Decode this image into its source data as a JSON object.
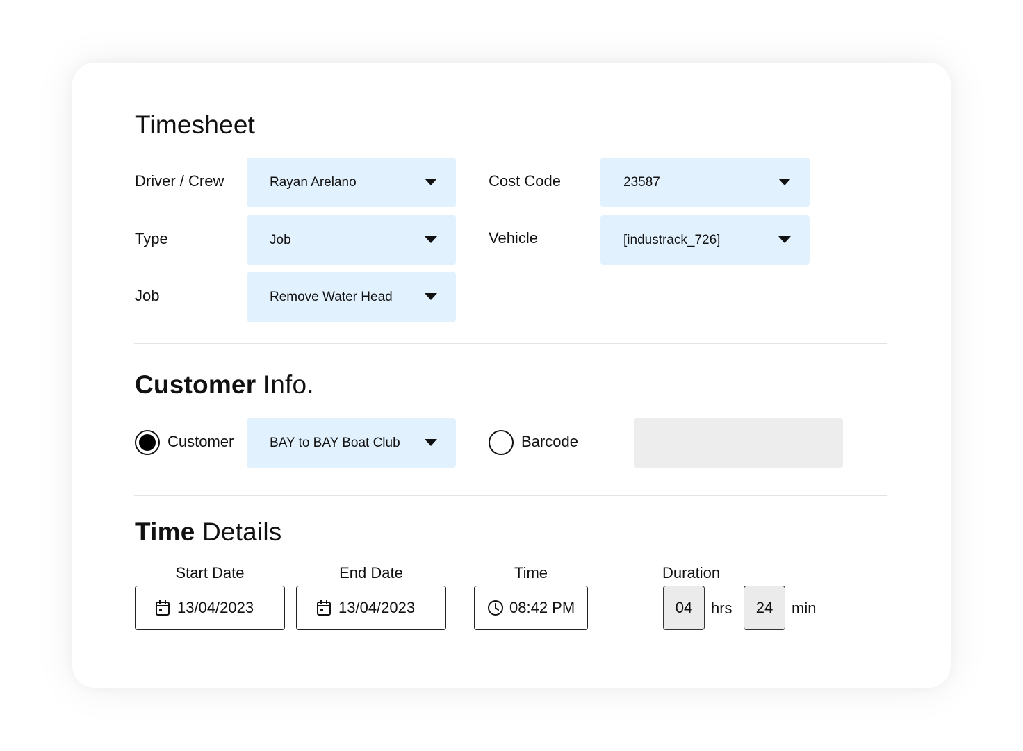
{
  "timesheet": {
    "title": "Timesheet",
    "driver": {
      "label": "Driver / Crew",
      "value": "Rayan Arelano"
    },
    "type": {
      "label": "Type",
      "value": "Job"
    },
    "job": {
      "label": "Job",
      "value": "Remove Water Head"
    },
    "cost_code": {
      "label": "Cost Code",
      "value": "23587"
    },
    "vehicle": {
      "label": "Vehicle",
      "value": "[industrack_726]"
    }
  },
  "customer_info": {
    "title_bold": "Customer",
    "title_rest": " Info.",
    "customer_option": {
      "label": "Customer",
      "selected": true,
      "value": "BAY to BAY Boat Club"
    },
    "barcode_option": {
      "label": "Barcode",
      "selected": false,
      "value": ""
    }
  },
  "time_details": {
    "title_bold": "Time",
    "title_rest": " Details",
    "start_date": {
      "label": "Start Date",
      "value": "13/04/2023",
      "icon": "calendar-icon"
    },
    "end_date": {
      "label": "End Date",
      "value": "13/04/2023",
      "icon": "calendar-icon"
    },
    "time": {
      "label": "Time",
      "value": "08:42 PM",
      "icon": "clock-icon"
    },
    "duration": {
      "label": "Duration",
      "hours": "04",
      "hours_unit": "hrs",
      "minutes": "24",
      "minutes_unit": "min"
    }
  },
  "colors": {
    "select_bg": "#e2f1fe",
    "disabled_bg": "#ededed",
    "text": "#111111"
  }
}
